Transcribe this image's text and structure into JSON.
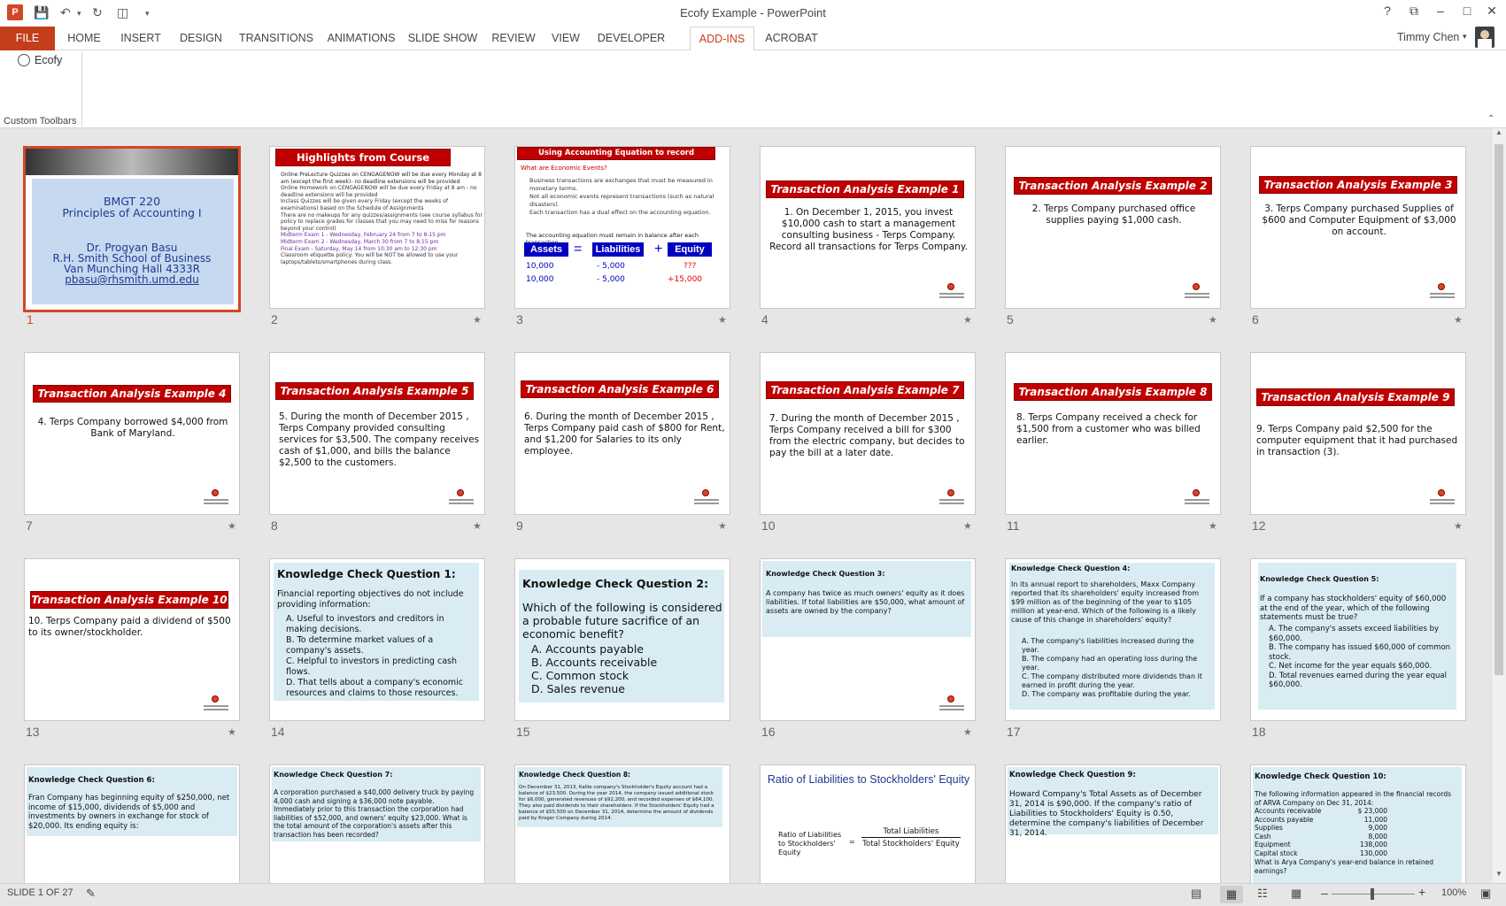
{
  "window": {
    "title": "Ecofy Example - PowerPoint",
    "help": "?",
    "user": "Timmy Chen"
  },
  "tabs": [
    "FILE",
    "HOME",
    "INSERT",
    "DESIGN",
    "TRANSITIONS",
    "ANIMATIONS",
    "SLIDE SHOW",
    "REVIEW",
    "VIEW",
    "DEVELOPER",
    "ADD-INS",
    "ACROBAT"
  ],
  "ribbon": {
    "button": "Ecofy",
    "group": "Custom Toolbars"
  },
  "slides": {
    "s1": {
      "title": "BMGT 220",
      "sub": "Principles of Accounting I",
      "l1": "Dr. Progyan Basu",
      "l2": "R.H. Smith School of Business",
      "l3": "Van Munching Hall 4333R",
      "l4": "pbasu@rhsmith.umd.edu"
    },
    "s2": {
      "title": "Highlights from Course Syllabus:",
      "b": [
        "Online PreLecture Quizzes on CENGAGENOW will be due every Monday at 8 am (except the first week)- no deadline extensions will be provided",
        "Online Homework on CENGAGENOW will be due every Friday at 8 am - no deadline extensions will be provided",
        "Inclass Quizzes will be given every Friday (except the weeks of examinations) based on the Schedule of Assignments",
        "There are no makeups for any quizzes/assignments (see course syllabus for policy to replace grades for classes that you may need to miss for reasons beyond your control)",
        "Midterm Exam 1 - Wednesday, February 24 from 7 to 8:15 pm",
        "Midterm Exam 2 - Wednesday, March 30 from 7 to 8:15 pm",
        "Final Exam - Saturday, May 14 from 10:30 am to 12:30 pm",
        "Classroom etiquette policy: You will be NOT be allowed to use your laptops/tablets/smartphones during class."
      ]
    },
    "s3": {
      "title": "Using Accounting Equation to record economic events",
      "q": "What are Economic Events?",
      "b": [
        "Business transactions are exchanges that must be measured in monetary terms.",
        "Not all economic events represent transactions (such as natural disasters).",
        "Each transaction has a dual effect on the accounting equation."
      ],
      "note": "The accounting equation must remain in balance after each transaction.",
      "eq": [
        "Assets",
        "=",
        "Liabilities",
        "+",
        "Equity"
      ],
      "r1": [
        "10,000",
        "- 5,000",
        "???"
      ],
      "r2": [
        "10,000",
        "- 5,000",
        "+15,000"
      ]
    },
    "s4": {
      "title": "Transaction Analysis Example 1",
      "text": "1. On December 1, 2015, you invest $10,000 cash to start a management consulting business - Terps Company. Record all transactions for Terps Company."
    },
    "s5": {
      "title": "Transaction Analysis Example 2",
      "text": "2. Terps Company purchased office supplies paying $1,000 cash."
    },
    "s6": {
      "title": "Transaction Analysis Example 3",
      "text": "3. Terps Company purchased Supplies of $600 and Computer Equipment of $3,000 on account."
    },
    "s7": {
      "title": "Transaction Analysis Example 4",
      "text": "4. Terps Company borrowed $4,000 from Bank of Maryland."
    },
    "s8": {
      "title": "Transaction Analysis Example 5",
      "text": "5. During the month of December 2015 , Terps Company provided consulting services for $3,500. The company receives cash of $1,000, and bills the balance $2,500 to the customers."
    },
    "s9": {
      "title": "Transaction Analysis Example 6",
      "text": "6. During the month of December 2015 , Terps Company paid cash of $800 for Rent, and $1,200 for Salaries to its only employee."
    },
    "s10": {
      "title": "Transaction Analysis Example 7",
      "text": "7. During the month of December 2015 , Terps Company received a bill for $300 from the electric company, but decides to pay the bill at a later date."
    },
    "s11": {
      "title": "Transaction Analysis Example 8",
      "text": "8. Terps Company received a check for $1,500 from a customer who was billed earlier."
    },
    "s12": {
      "title": "Transaction Analysis Example 9",
      "text": "9. Terps Company paid $2,500 for the computer equipment that it had purchased in transaction (3)."
    },
    "s13": {
      "title": "Transaction Analysis Example 10",
      "text": "10. Terps Company paid a dividend of $500 to its owner/stockholder."
    },
    "s14": {
      "title": "Knowledge Check Question 1:",
      "text": "Financial reporting objectives do not include providing information:",
      "o": [
        "A. Useful to investors and creditors in making decisions.",
        "B. To determine market values of a company's assets.",
        "C. Helpful to investors in predicting cash flows.",
        "D. That tells about a company's economic resources and claims to those resources."
      ]
    },
    "s15": {
      "title": "Knowledge Check Question 2:",
      "text": "Which of the following is considered a probable future sacrifice of an economic benefit?",
      "o": [
        "A.   Accounts payable",
        "B.   Accounts receivable",
        "C.   Common stock",
        "D.   Sales revenue"
      ]
    },
    "s16": {
      "title": "Knowledge Check Question 3:",
      "text": "A company has twice as much owners' equity as it does liabilities. If total liabilities are $50,000, what amount of assets are owned by the company?"
    },
    "s17": {
      "title": "Knowledge Check Question 4:",
      "text": "In its annual report to shareholders, Maxx Company reported that its shareholders' equity increased from $99 million as of the beginning of the year to $105 million at year-end. Which of the following is a likely cause of this change in shareholders' equity?",
      "o": [
        "A. The company's liabilities increased during the year.",
        "B. The company had an operating loss during the year.",
        "C. The company distributed more dividends than it earned in profit during the year.",
        "D. The company was profitable during the year."
      ]
    },
    "s18": {
      "title": "Knowledge Check Question 5:",
      "text": "If a company has stockholders' equity of $60,000 at the end of the year, which of the following statements must be true?",
      "o": [
        "A. The company's assets exceed liabilities by $60,000.",
        "B. The company has issued $60,000 of common stock.",
        "C. Net income for the year equals $60,000.",
        "D. Total revenues earned during the year equal $60,000."
      ]
    },
    "s19": {
      "title": "Knowledge Check Question 6:",
      "text": "Fran Company has beginning equity of $250,000, net income of $15,000, dividends of $5,000 and investments by owners in exchange for stock of $20,000. Its ending equity is:"
    },
    "s20": {
      "title": "Knowledge Check Question 7:",
      "text": "A corporation purchased a $40,000 delivery truck by paying 4,000 cash and signing a $36,000 note payable. Immediately prior to this transaction the corporation had liabilities of $52,000, and owners' equity $23,000. What is the total amount of the corporation's assets after this transaction has been recorded?"
    },
    "s21": {
      "title": "Knowledge Check Question 8:",
      "text": "On December 31, 2013, Kallie company's Stockholder's Equity account had a balance of $23,500. During the year 2014, the company issued additional stock for $6,000, generated revenues of $92,200, and recorded expenses of $64,100. They also paid dividends to their shareholders. If the Stockholders' Equity had a balance of $55,500 on December 31, 2014, determine the amount of dividends paid by Kroger Company during 2014."
    },
    "s22": {
      "title": "Ratio of Liabilities to Stockholders' Equity",
      "lhs": "Ratio of Liabilities to Stockholders' Equity",
      "eq": "=",
      "num": "Total Liabilities",
      "den": "Total Stockholders' Equity"
    },
    "s23": {
      "title": "Knowledge Check Question 9:",
      "text": "Howard Company's Total Assets as of December 31, 2014 is $90,000. If the company's ratio of Liabilities to Stockholders' Equity is 0.50, determine the company's liabilities of December 31, 2014."
    },
    "s24": {
      "title": "Knowledge Check Question 10:",
      "text": "The following information appeared in the financial records of ARVA Company on Dec 31, 2014:",
      "rows": [
        [
          "Accounts receivable",
          "$   23,000"
        ],
        [
          "Accounts payable",
          "11,000"
        ],
        [
          "Supplies",
          "9,000"
        ],
        [
          "Cash",
          "8,000"
        ],
        [
          "Equipment",
          "138,000"
        ],
        [
          "Capital stock",
          "130,000"
        ]
      ],
      "q": "What is Arya Company's year-end balance in retained earnings?"
    }
  },
  "status": {
    "slide": "SLIDE 1 OF 27",
    "zoom": "100%"
  }
}
